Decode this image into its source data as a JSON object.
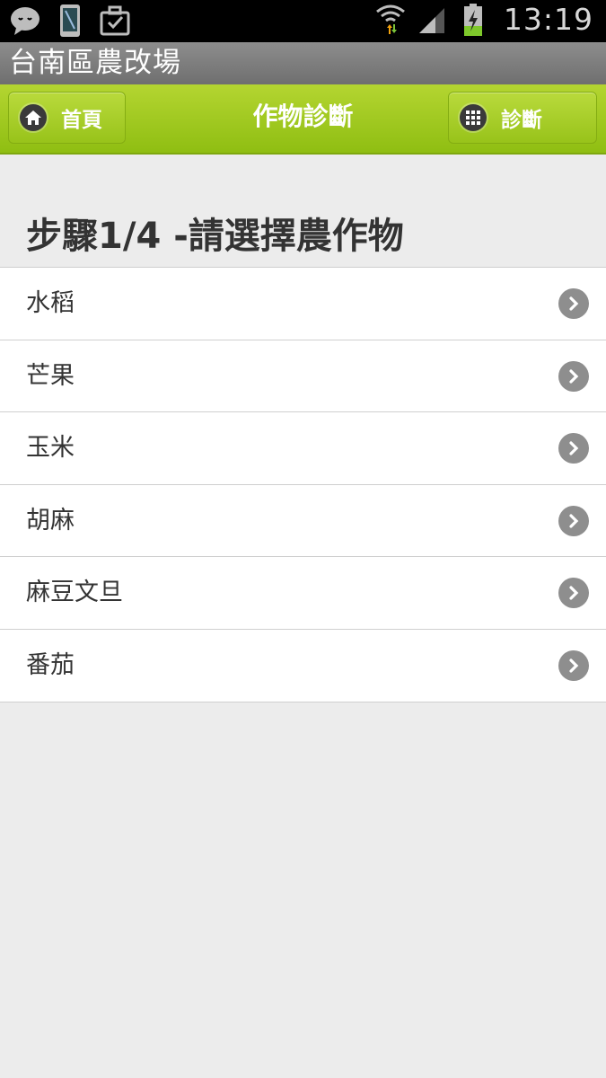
{
  "status_bar": {
    "time": "13:19",
    "left_icons": [
      "chat-icon",
      "phone-icon",
      "briefcase-check-icon"
    ],
    "right_icons": [
      "wifi-icon",
      "signal-icon",
      "battery-charging-icon"
    ]
  },
  "app": {
    "title": "台南區農改場"
  },
  "header": {
    "home_label": "首頁",
    "title": "作物診斷",
    "diagnosis_label": "診斷"
  },
  "page": {
    "step_heading": "步驟1/4 -請選擇農作物"
  },
  "crops": {
    "items": [
      {
        "label": "水稻"
      },
      {
        "label": "芒果"
      },
      {
        "label": "玉米"
      },
      {
        "label": "胡麻"
      },
      {
        "label": "麻豆文旦"
      },
      {
        "label": "番茄"
      }
    ]
  },
  "colors": {
    "header_green": "#9cc41e",
    "titlebar_gray": "#7e7e7e",
    "background": "#ececec"
  }
}
